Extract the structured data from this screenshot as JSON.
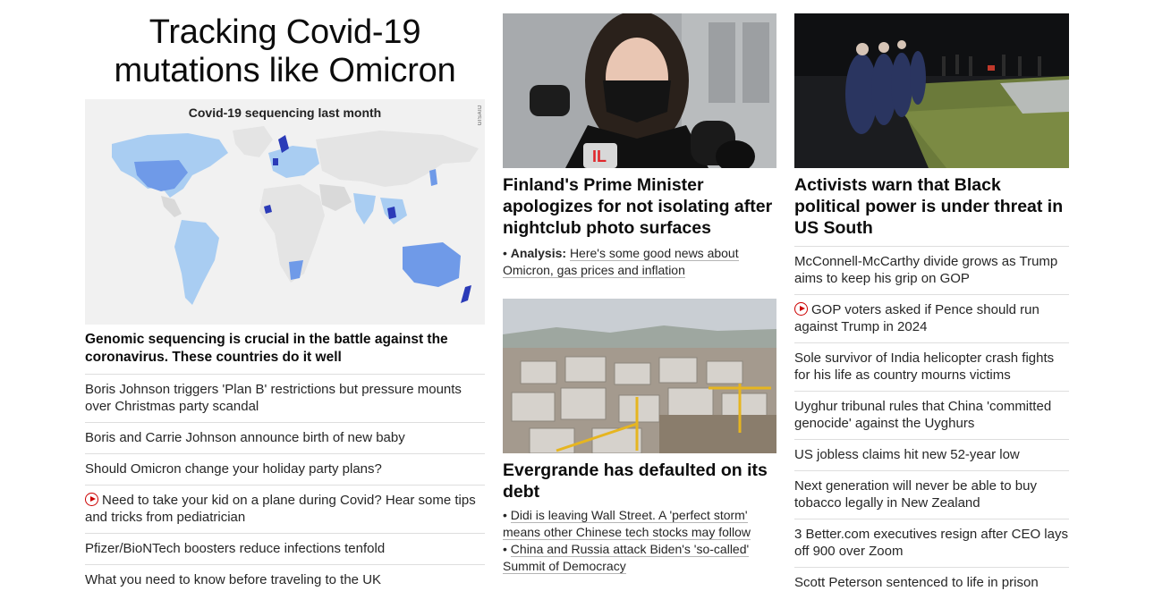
{
  "lead": {
    "banner_title": "Tracking Covid-19 mutations like Omicron",
    "map": {
      "title": "Covid-19 sequencing last month",
      "credit": "GISAID"
    },
    "headline": "Genomic sequencing is crucial in the battle against the coronavirus. These countries do it well",
    "items": [
      {
        "text": "Boris Johnson triggers 'Plan B' restrictions but pressure mounts over Christmas party scandal",
        "video": false
      },
      {
        "text": "Boris and Carrie Johnson announce birth of new baby",
        "video": false
      },
      {
        "text": "Should Omicron change your holiday party plans?",
        "video": false
      },
      {
        "text": "Need to take your kid on a plane during Covid? Hear some tips and tricks from pediatrician",
        "video": true
      },
      {
        "text": "Pfizer/BioNTech boosters reduce infections tenfold",
        "video": false
      },
      {
        "text": "What you need to know before traveling to the UK",
        "video": false
      }
    ]
  },
  "middle": {
    "story1": {
      "headline": "Finland's Prime Minister apologizes for not isolating after nightclub photo surfaces",
      "analysis_label": "Analysis:",
      "analysis_text": "Here's some good news about Omicron, gas prices and inflation"
    },
    "story2": {
      "headline": "Evergrande has defaulted on its debt",
      "links": [
        "Didi is leaving Wall Street. A 'perfect storm' means other Chinese tech stocks may follow",
        "China and Russia attack Biden's 'so-called' Summit of Democracy"
      ]
    },
    "bullet": "•"
  },
  "right": {
    "headline": "Activists warn that Black political power is under threat in US South",
    "items": [
      {
        "text": "McConnell-McCarthy divide grows as Trump aims to keep his grip on GOP",
        "video": false
      },
      {
        "text": "GOP voters asked if Pence should run against Trump in 2024",
        "video": true
      },
      {
        "text": "Sole survivor of India helicopter crash fights for his life as country mourns victims",
        "video": false
      },
      {
        "text": "Uyghur tribunal rules that China 'committed genocide' against the Uyghurs",
        "video": false
      },
      {
        "text": "US jobless claims hit new 52-year low",
        "video": false
      },
      {
        "text": "Next generation will never be able to buy tobacco legally in New Zealand",
        "video": false
      },
      {
        "text": "3 Better.com executives resign after CEO lays off 900 over Zoom",
        "video": false
      },
      {
        "text": "Scott Peterson sentenced to life in prison",
        "video": false
      }
    ]
  },
  "colors": {
    "link_red": "#cc0000",
    "divider": "#dedede",
    "map_light": "#a9cdf2",
    "map_mid": "#6f9ae8",
    "map_dark": "#2b3bb8"
  }
}
